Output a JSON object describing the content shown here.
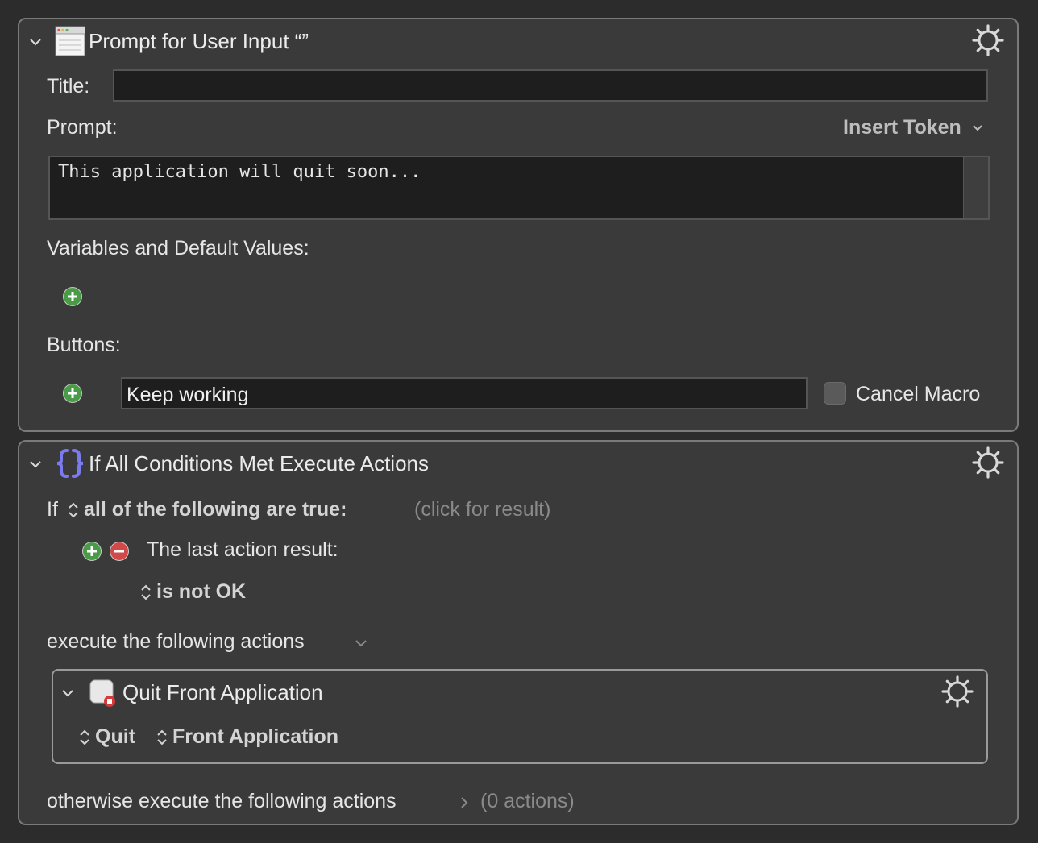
{
  "prompt_action": {
    "title": "Prompt for User Input “”",
    "title_label": "Title:",
    "title_value": "",
    "prompt_label": "Prompt:",
    "insert_token": "Insert Token",
    "prompt_text": "This application will quit soon...",
    "variables_label": "Variables and Default Values:",
    "buttons_label": "Buttons:",
    "button_value": "Keep working",
    "cancel_macro": "Cancel Macro"
  },
  "if_action": {
    "title": "If All Conditions Met Execute Actions",
    "if_label": "If",
    "condition_mode": "all of the following are true:",
    "click_result": "(click for result)",
    "condition_label": "The last action result:",
    "condition_value": "is not OK",
    "execute_label": "execute the following actions",
    "otherwise_label": "otherwise execute the following actions",
    "otherwise_count": "(0 actions)"
  },
  "quit_action": {
    "title": "Quit Front Application",
    "mode": "Quit",
    "target": "Front Application"
  },
  "colors": {
    "background": "#2c2c2c",
    "panel": "#3a3a3a",
    "add_green": "#4a9b48",
    "remove_red": "#d04a4a",
    "braces_purple": "#7b7bf0"
  }
}
